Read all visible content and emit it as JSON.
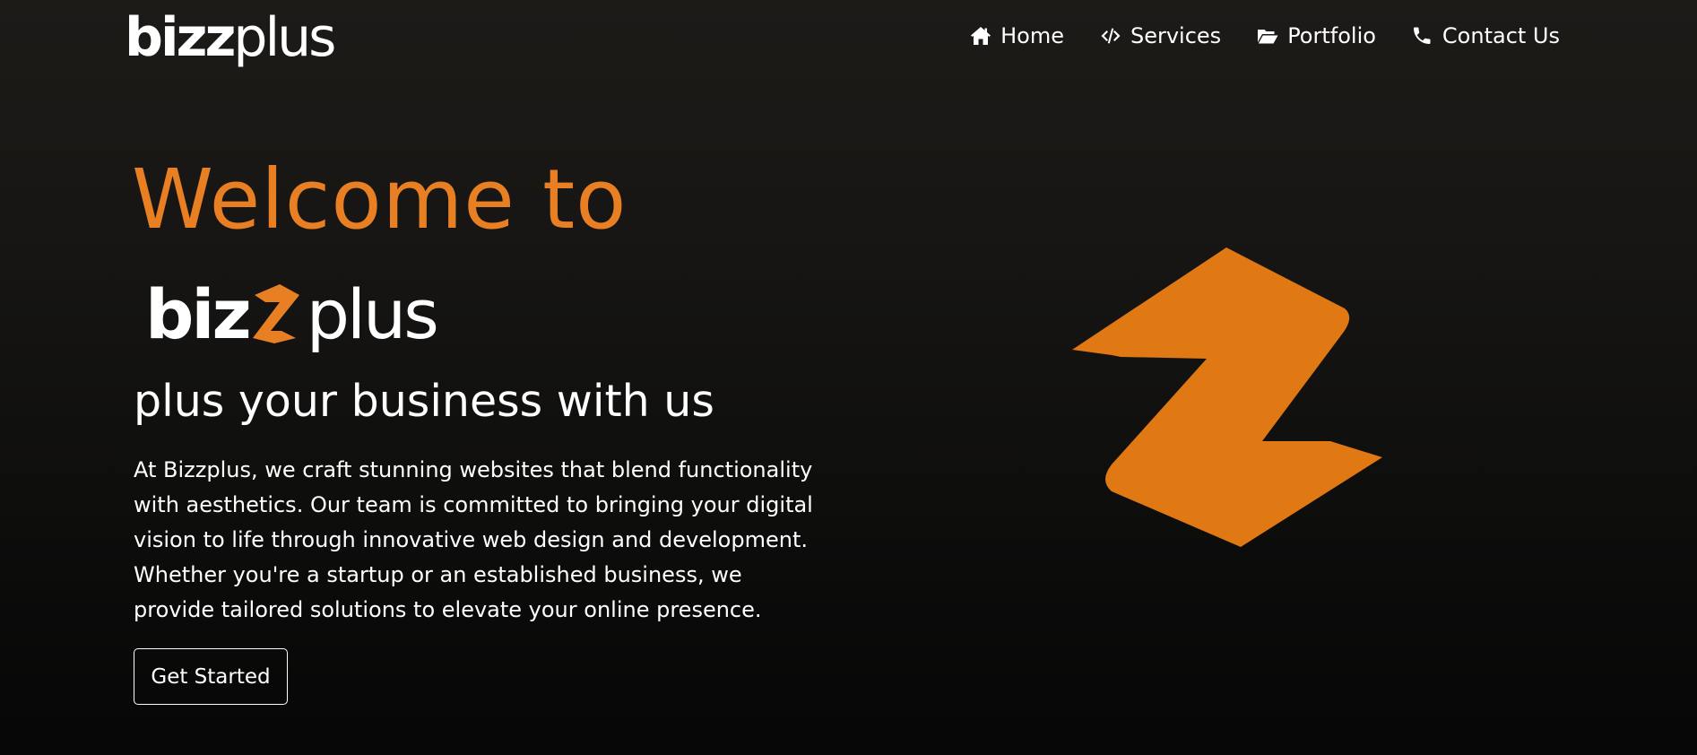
{
  "header": {
    "logo": {
      "bold": "bizz",
      "light": "plus"
    },
    "nav": [
      {
        "label": "Home",
        "icon": "home-icon"
      },
      {
        "label": "Services",
        "icon": "code-icon"
      },
      {
        "label": "Portfolio",
        "icon": "folder-open-icon"
      },
      {
        "label": "Contact Us",
        "icon": "phone-icon"
      }
    ]
  },
  "hero": {
    "title": "Welcome to",
    "brand": {
      "part1": "bi",
      "part2": "z",
      "part3": "plus"
    },
    "tagline": "plus your business with us",
    "description": "At Bizzplus, we craft stunning websites that blend functionality with aesthetics. Our team is committed to bringing your digital vision to life through innovative web design and development. Whether you're a startup or an established business, we provide tailored solutions to elevate your online presence.",
    "cta_label": "Get Started"
  },
  "colors": {
    "accent": "#e88023",
    "graphic": "#e07814",
    "text": "#ffffff",
    "background_top": "#1d1b18",
    "background_bottom": "#060606"
  }
}
